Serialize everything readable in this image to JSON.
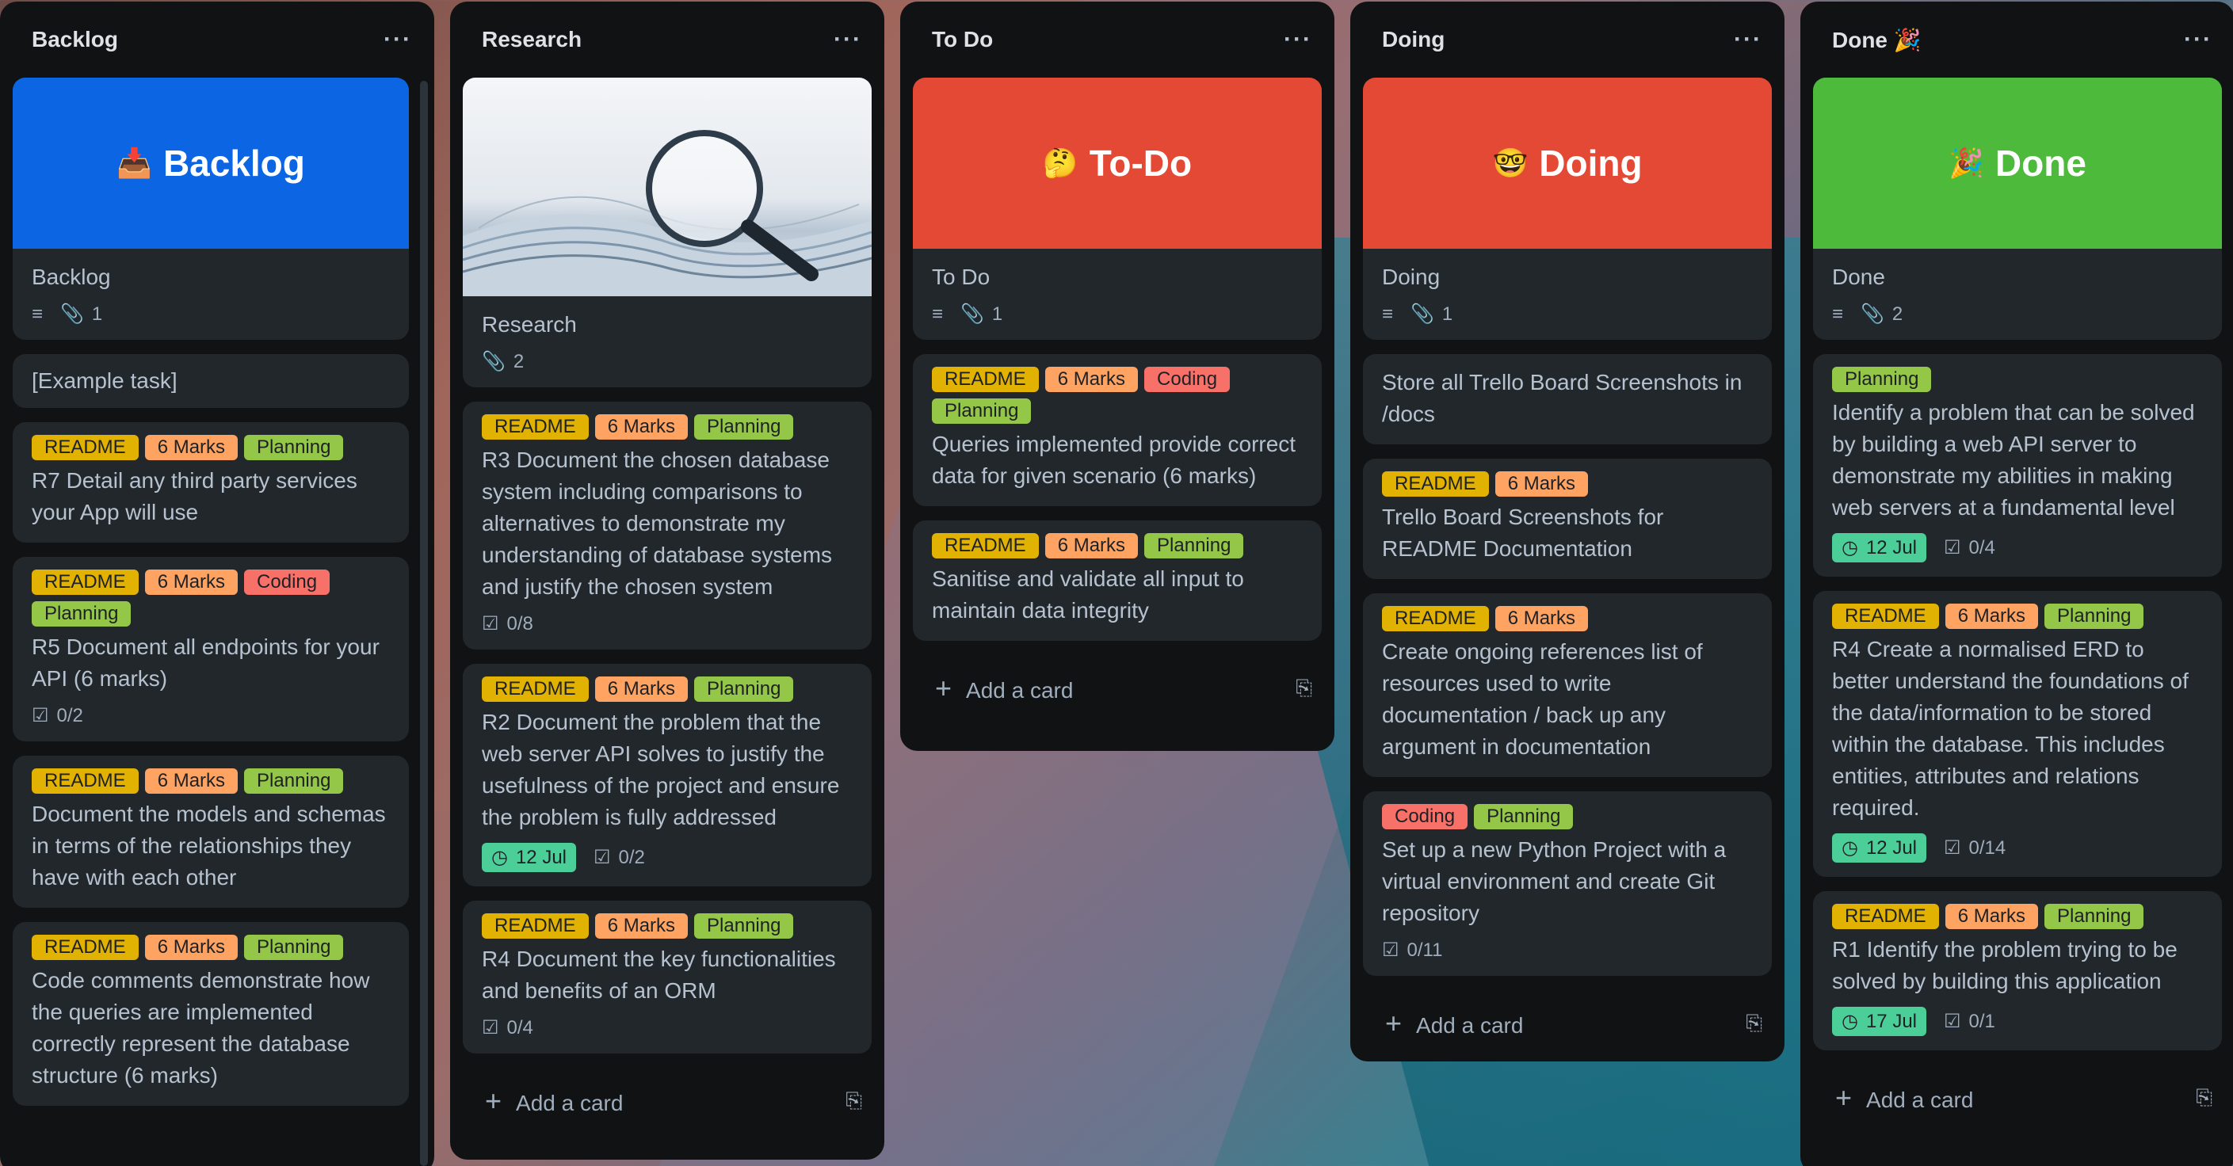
{
  "colors": {
    "readme": "#e2b203",
    "marks": "#fea362",
    "planning": "#94c748",
    "coding": "#f87168",
    "blue_cover": "#0c66e4",
    "red_cover": "#e34935",
    "green_cover": "#4dba3c"
  },
  "lists": {
    "backlog": {
      "title": "Backlog",
      "cover_card": {
        "cover_emoji": "📥",
        "cover_text": "Backlog",
        "title": "Backlog",
        "attachments": "1"
      },
      "cards": [
        {
          "title": "[Example task]"
        },
        {
          "labels": [
            "README",
            "6 Marks",
            "Planning"
          ],
          "title": "R7 Detail any third party services your App will use"
        },
        {
          "labels": [
            "README",
            "6 Marks",
            "Coding",
            "Planning"
          ],
          "title": "R5 Document all endpoints for your API (6 marks)",
          "checklist": "0/2"
        },
        {
          "labels": [
            "README",
            "6 Marks",
            "Planning"
          ],
          "title": "Document the models and schemas in terms of the relationships they have with each other"
        },
        {
          "labels": [
            "README",
            "6 Marks",
            "Planning"
          ],
          "title": "Code comments demonstrate how the queries are implemented correctly represent the database structure (6 marks)"
        }
      ]
    },
    "research": {
      "title": "Research",
      "cover_card": {
        "title": "Research",
        "attachments": "2"
      },
      "cards": [
        {
          "labels": [
            "README",
            "6 Marks",
            "Planning"
          ],
          "title": "R3 Document the chosen database system including comparisons to alternatives to demonstrate my understanding of database systems and justify the chosen system",
          "checklist": "0/8"
        },
        {
          "labels": [
            "README",
            "6 Marks",
            "Planning"
          ],
          "title": "R2 Document the problem that the web server API solves to justify the usefulness of the project and ensure the problem is fully addressed",
          "date": "12 Jul",
          "checklist": "0/2"
        },
        {
          "labels": [
            "README",
            "6 Marks",
            "Planning"
          ],
          "title": "R4 Document the key functionalities and benefits of an ORM",
          "checklist": "0/4"
        }
      ],
      "add_card": "Add a card"
    },
    "todo": {
      "title": "To Do",
      "cover_card": {
        "cover_emoji": "🤔",
        "cover_text": "To-Do",
        "title": "To Do",
        "attachments": "1"
      },
      "cards": [
        {
          "labels": [
            "README",
            "6 Marks",
            "Coding",
            "Planning"
          ],
          "title": "Queries implemented provide correct data for given scenario (6 marks)"
        },
        {
          "labels": [
            "README",
            "6 Marks",
            "Planning"
          ],
          "title": "Sanitise and validate all input to maintain data integrity"
        }
      ],
      "add_card": "Add a card"
    },
    "doing": {
      "title": "Doing",
      "cover_card": {
        "cover_emoji": "🤓",
        "cover_text": "Doing",
        "title": "Doing",
        "attachments": "1"
      },
      "cards": [
        {
          "title": "Store all Trello Board Screenshots in /docs"
        },
        {
          "labels": [
            "README",
            "6 Marks"
          ],
          "title": "Trello Board Screenshots for README Documentation"
        },
        {
          "labels": [
            "README",
            "6 Marks"
          ],
          "title": "Create ongoing references list of resources used to write documentation / back up any argument in documentation"
        },
        {
          "labels": [
            "Coding",
            "Planning"
          ],
          "title": "Set up a new Python Project with a virtual environment and create Git repository",
          "checklist": "0/11"
        }
      ],
      "add_card": "Add a card"
    },
    "done": {
      "title": "Done 🎉",
      "cover_card": {
        "cover_emoji": "🎉",
        "cover_text": "Done",
        "title": "Done",
        "attachments": "2"
      },
      "cards": [
        {
          "labels": [
            "Planning"
          ],
          "title": "Identify a problem that can be solved by building a web API server to demonstrate my abilities in making web servers at a fundamental level",
          "date": "12 Jul",
          "checklist": "0/4"
        },
        {
          "labels": [
            "README",
            "6 Marks",
            "Planning"
          ],
          "title": "R4 Create a normalised ERD to better understand the foundations of the data/information to be stored within the database. This includes entities, attributes and relations required.",
          "date": "12 Jul",
          "checklist": "0/14"
        },
        {
          "labels": [
            "README",
            "6 Marks",
            "Planning"
          ],
          "title": "R1 Identify the problem trying to be solved by building this application",
          "date": "17 Jul",
          "checklist": "0/1"
        }
      ],
      "add_card": "Add a card"
    }
  }
}
